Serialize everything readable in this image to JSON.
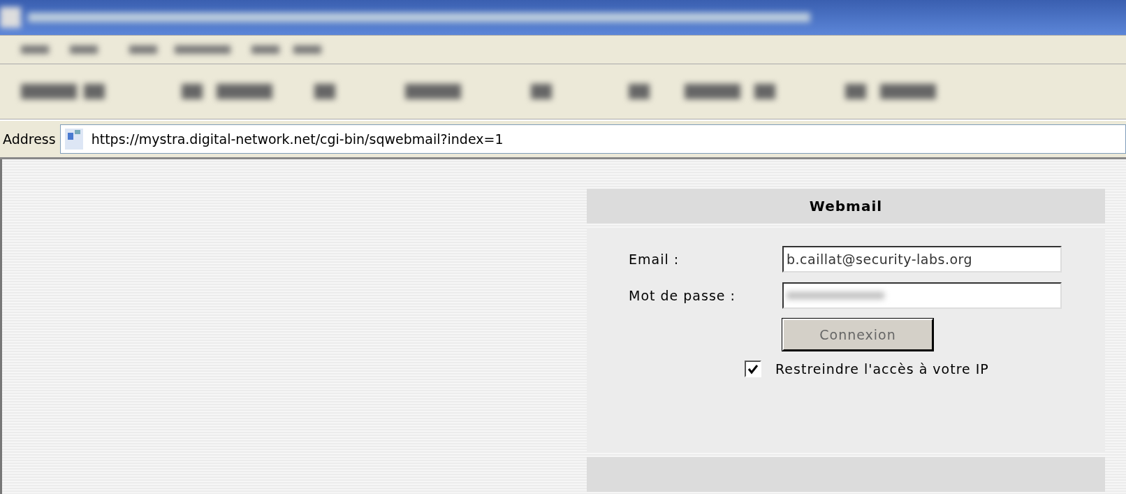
{
  "address_bar": {
    "label": "Address",
    "url": "https://mystra.digital-network.net/cgi-bin/sqwebmail?index=1"
  },
  "login": {
    "title": "Webmail",
    "email_label": "Email :",
    "email_value": "b.caillat@security-labs.org",
    "password_label": "Mot de passe :",
    "button": "Connexion",
    "restrict": {
      "label": "Restreindre l'accès à votre IP",
      "checked": true
    }
  }
}
